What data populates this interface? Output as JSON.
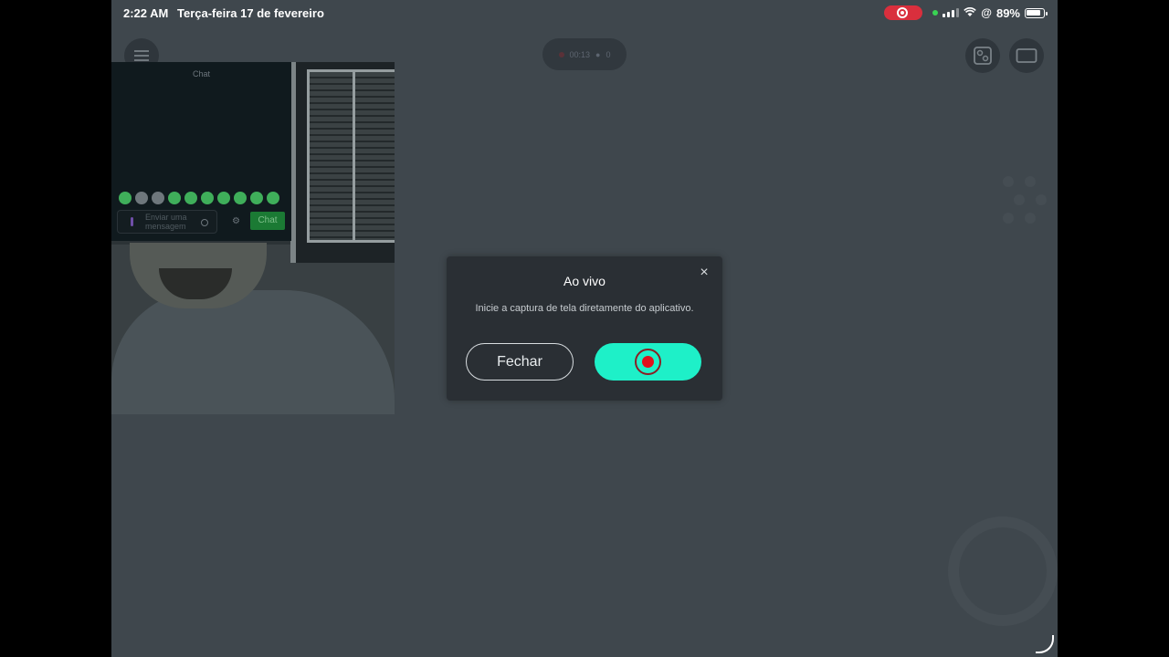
{
  "statusbar": {
    "time": "2:22 AM",
    "date": "Terça-feira 17 de fevereiro",
    "battery": "89%"
  },
  "top": {
    "timer": "00:13",
    "viewers": "0"
  },
  "chat": {
    "title": "Chat",
    "input_placeholder": "Enviar uma mensagem",
    "send_label": "Chat"
  },
  "dialog": {
    "title": "Ao vivo",
    "message": "Inicie a captura de tela diretamente do aplicativo.",
    "close_label": "Fechar",
    "close_icon": "×"
  },
  "colors": {
    "accent": "#1ef0c8",
    "record_red": "#e0111d",
    "background": "#3f474d"
  }
}
